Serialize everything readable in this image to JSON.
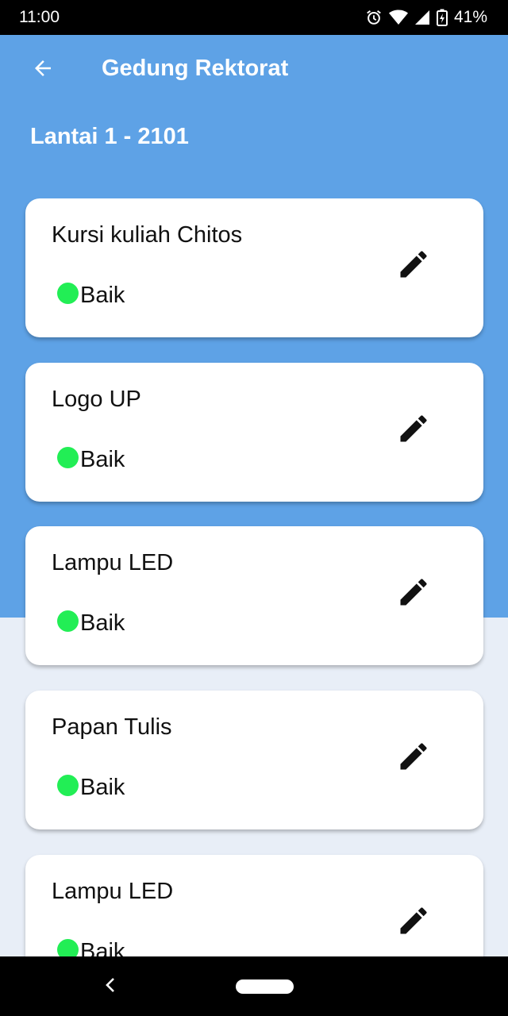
{
  "status_bar": {
    "time": "11:00",
    "battery": "41%",
    "icons": [
      "alarm-icon",
      "wifi-icon",
      "signal-icon",
      "battery-icon"
    ]
  },
  "app_bar": {
    "back_icon": "arrow-left-icon",
    "title": "Gedung Rektorat"
  },
  "floor": {
    "title": "Lantai 1 - 2101"
  },
  "colors": {
    "header": "#5ea2e6",
    "background": "#e8eef7",
    "status_good": "#22ee55"
  },
  "items": [
    {
      "name": "Kursi kuliah Chitos",
      "status": "Baik",
      "edit_icon": "pencil-icon"
    },
    {
      "name": "Logo UP",
      "status": "Baik",
      "edit_icon": "pencil-icon"
    },
    {
      "name": "Lampu LED",
      "status": "Baik",
      "edit_icon": "pencil-icon"
    },
    {
      "name": "Papan Tulis",
      "status": "Baik",
      "edit_icon": "pencil-icon"
    },
    {
      "name": "Lampu LED",
      "status": "Baik",
      "edit_icon": "pencil-icon"
    }
  ]
}
